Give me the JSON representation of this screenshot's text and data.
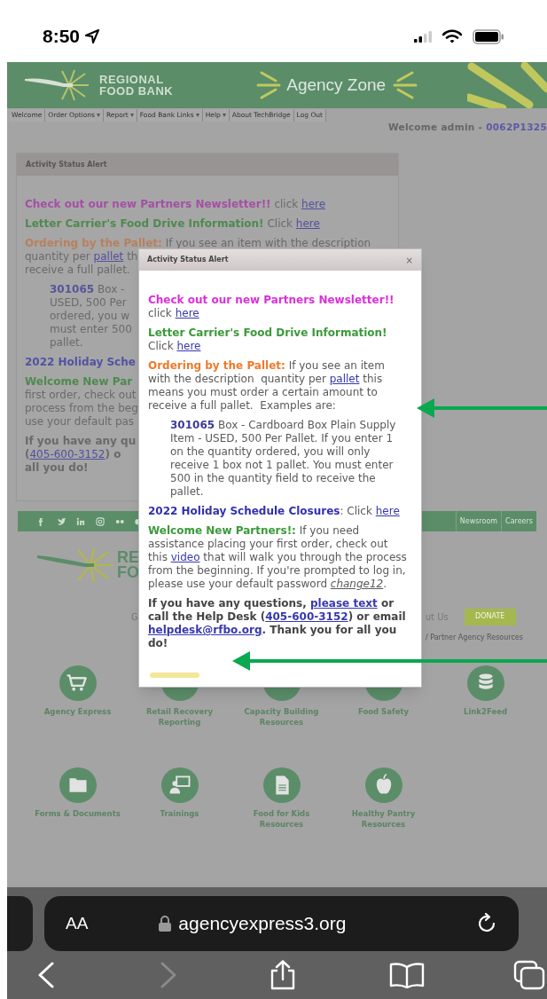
{
  "status_bar": {
    "time": "8:50"
  },
  "site_header": {
    "logo_lines": [
      "REGIONAL",
      "FOOD BANK"
    ],
    "title": "Agency Zone"
  },
  "nav": {
    "items": [
      {
        "label": "Welcome",
        "has_menu": false
      },
      {
        "label": "Order Options",
        "has_menu": true
      },
      {
        "label": "Report",
        "has_menu": true
      },
      {
        "label": "Food Bank Links",
        "has_menu": true
      },
      {
        "label": "Help",
        "has_menu": true
      },
      {
        "label": "About TechBridge",
        "has_menu": false
      },
      {
        "label": "Log Out",
        "has_menu": false
      }
    ],
    "welcome": "Welcome admin - ",
    "account": "0062P1325"
  },
  "background_alert": {
    "title": "Activity Status Alert",
    "paragraphs": [
      {
        "kind": "message",
        "lines": [
          [
            {
              "kind": "heading",
              "color": "#a64fa6",
              "text": "Check out our new Partners Newsletter!!"
            },
            {
              "kind": "text",
              "text": " click "
            },
            {
              "kind": "link",
              "text": "here"
            }
          ]
        ]
      },
      {
        "kind": "message",
        "lines": [
          [
            {
              "kind": "heading",
              "color": "#4e8a4e",
              "text": "Letter Carrier's Food Drive Information!"
            },
            {
              "kind": "text",
              "text": " Click "
            },
            {
              "kind": "link",
              "text": "here"
            }
          ]
        ]
      },
      {
        "kind": "message",
        "lines": [
          [
            {
              "kind": "heading",
              "color": "#b8805e",
              "text": "Ordering by the Pallet:"
            },
            {
              "kind": "text",
              "text": " If you see an item with the description"
            }
          ],
          [
            {
              "kind": "text",
              "text": "quantity per "
            },
            {
              "kind": "link",
              "text": "pallet"
            },
            {
              "kind": "text",
              "text": " th"
            }
          ],
          [
            {
              "kind": "text",
              "text": "receive a full pallet."
            }
          ]
        ]
      },
      {
        "kind": "example",
        "lines": [
          [
            {
              "kind": "number",
              "text": "301065"
            },
            {
              "kind": "text",
              "text": " Box -"
            }
          ],
          [
            {
              "kind": "text",
              "text": "USED, 500 Per"
            }
          ],
          [
            {
              "kind": "text",
              "text": "ordered, you w"
            }
          ],
          [
            {
              "kind": "text",
              "text": "must enter 500"
            }
          ],
          [
            {
              "kind": "text",
              "text": "pallet."
            }
          ]
        ]
      },
      {
        "kind": "message",
        "lines": [
          [
            {
              "kind": "heading",
              "color": "#5252a3",
              "text": "2022 Holiday Sche"
            }
          ]
        ]
      },
      {
        "kind": "message",
        "lines": [
          [
            {
              "kind": "heading",
              "color": "#4e8a4e",
              "text": "Welcome New Par"
            }
          ],
          [
            {
              "kind": "text",
              "text": "first order, check out"
            }
          ],
          [
            {
              "kind": "text",
              "text": "process from the beg"
            }
          ],
          [
            {
              "kind": "text",
              "text": "use your default pas"
            }
          ]
        ]
      },
      {
        "kind": "message",
        "lines": [
          [
            {
              "kind": "strong",
              "text": "If you have any qu"
            }
          ],
          [
            {
              "kind": "strong",
              "text": "("
            },
            {
              "kind": "link",
              "text": "405-600-3152"
            },
            {
              "kind": "strong",
              "text": ") o"
            }
          ],
          [
            {
              "kind": "strong",
              "text": "all you do!"
            }
          ]
        ]
      }
    ]
  },
  "footer": {
    "links": [
      "Newsroom",
      "Careers"
    ],
    "logo_fragments": [
      "RE",
      "FO"
    ],
    "left_fragment": "G",
    "right_fragment": "ut Us",
    "donate": "DONATE",
    "breadcrumb": "/ Partner Agency Resources"
  },
  "quick_links": [
    [
      {
        "label": "Agency Express",
        "kind": "cart"
      },
      {
        "label": "Retail Recovery Reporting",
        "kind": "covered"
      },
      {
        "label": "Capacity Building Resources",
        "kind": "covered"
      },
      {
        "label": "Food Safety",
        "kind": "covered"
      },
      {
        "label": "Link2Feed",
        "kind": "database"
      }
    ],
    [
      {
        "label": "Forms & Documents",
        "kind": "folder"
      },
      {
        "label": "Trainings",
        "kind": "presenter"
      },
      {
        "label": "Food for Kids Resources",
        "kind": "document"
      },
      {
        "label": "Healthy Pantry Resources",
        "kind": "apple"
      }
    ]
  ],
  "dialog": {
    "title": "Activity Status Alert",
    "close": "×",
    "paragraphs": [
      {
        "indent": false,
        "bold": false,
        "segments": [
          {
            "kind": "heading",
            "color": "#d92fd9",
            "text": "Check out our new Partners Newsletter!!"
          },
          {
            "kind": "text",
            "text": " click "
          },
          {
            "kind": "link",
            "text": "here"
          }
        ]
      },
      {
        "indent": false,
        "bold": false,
        "segments": [
          {
            "kind": "heading",
            "color": "#3a9a3a",
            "text": "Letter Carrier's Food Drive Information!"
          },
          {
            "kind": "text",
            "text": " Click "
          },
          {
            "kind": "link",
            "text": "here"
          }
        ]
      },
      {
        "indent": false,
        "bold": false,
        "segments": [
          {
            "kind": "heading",
            "color": "#ec7a2c",
            "text": "Ordering by the Pallet:"
          },
          {
            "kind": "text",
            "text": " If you see an item with the description  quantity per "
          },
          {
            "kind": "link",
            "text": "pallet"
          },
          {
            "kind": "text",
            "text": " this means you must order a certain amount to receive a full pallet.  Examples are:"
          }
        ]
      },
      {
        "indent": true,
        "bold": false,
        "segments": [
          {
            "kind": "number",
            "text": "301065"
          },
          {
            "kind": "text",
            "text": " Box - Cardboard Box Plain Supply Item - USED, 500 Per Pallet. If you enter 1 on the quantity ordered, you will only receive 1 box not 1 pallet. You must enter 500 in the quantity field to receive the pallet."
          }
        ]
      },
      {
        "indent": false,
        "bold": false,
        "segments": [
          {
            "kind": "heading",
            "color": "#3030b0",
            "text": "2022 Holiday Schedule Closures"
          },
          {
            "kind": "text",
            "text": ": Click "
          },
          {
            "kind": "link",
            "text": "here"
          }
        ]
      },
      {
        "indent": false,
        "bold": false,
        "segments": [
          {
            "kind": "heading",
            "color": "#3a9a3a",
            "text": "Welcome New Partners!:"
          },
          {
            "kind": "text",
            "text": " If you need assistance placing your first order, check out this "
          },
          {
            "kind": "link",
            "text": "video"
          },
          {
            "kind": "text",
            "text": " that will walk you through the process from the beginning. If you're prompted to log in, please use your default password "
          },
          {
            "kind": "password",
            "text": "change12"
          },
          {
            "kind": "text",
            "text": "."
          }
        ]
      },
      {
        "indent": false,
        "bold": true,
        "segments": [
          {
            "kind": "text",
            "text": "If you have any questions, "
          },
          {
            "kind": "link",
            "text": "please text"
          },
          {
            "kind": "text",
            "text": " or call the Help Desk ("
          },
          {
            "kind": "link",
            "text": "405-600-3152"
          },
          {
            "kind": "text",
            "text": ") or email "
          },
          {
            "kind": "link",
            "text": "helpdesk@rfbo.org"
          },
          {
            "kind": "text",
            "text": ". Thank you for all you do!"
          }
        ]
      }
    ]
  },
  "browser": {
    "text_size": "AA",
    "url": "agencyexpress3.org",
    "forward_disabled": true
  }
}
